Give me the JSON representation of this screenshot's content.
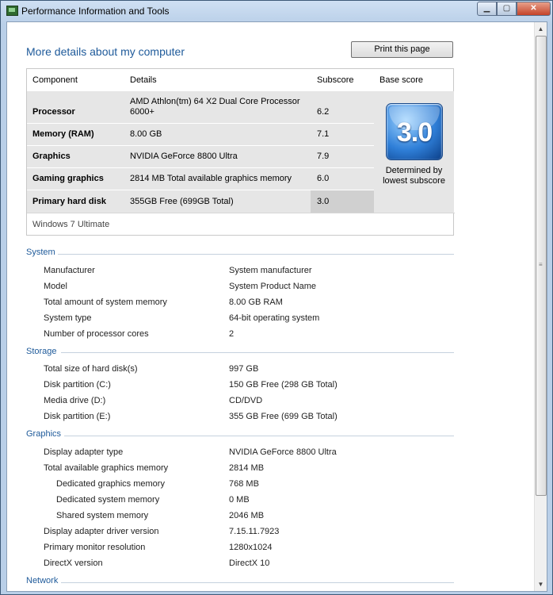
{
  "window": {
    "title": "Performance Information and Tools"
  },
  "header": {
    "heading": "More details about my computer",
    "print_label": "Print this page"
  },
  "score_table": {
    "columns": {
      "component": "Component",
      "details": "Details",
      "subscore": "Subscore",
      "base": "Base score"
    },
    "rows": [
      {
        "component": "Processor",
        "details": "AMD Athlon(tm) 64 X2 Dual Core Processor 6000+",
        "subscore": "6.2"
      },
      {
        "component": "Memory (RAM)",
        "details": "8.00 GB",
        "subscore": "7.1"
      },
      {
        "component": "Graphics",
        "details": "NVIDIA GeForce 8800 Ultra",
        "subscore": "7.9"
      },
      {
        "component": "Gaming graphics",
        "details": "2814 MB Total available graphics memory",
        "subscore": "6.0"
      },
      {
        "component": "Primary hard disk",
        "details": "355GB Free (699GB Total)",
        "subscore": "3.0"
      }
    ],
    "base_score": "3.0",
    "base_caption": "Determined by lowest subscore",
    "edition": "Windows 7 Ultimate"
  },
  "system": {
    "title": "System",
    "rows": [
      {
        "label": "Manufacturer",
        "value": "System manufacturer"
      },
      {
        "label": "Model",
        "value": "System Product Name"
      },
      {
        "label": "Total amount of system memory",
        "value": "8.00 GB RAM"
      },
      {
        "label": "System type",
        "value": "64-bit operating system"
      },
      {
        "label": "Number of processor cores",
        "value": "2"
      }
    ]
  },
  "storage": {
    "title": "Storage",
    "rows": [
      {
        "label": "Total size of hard disk(s)",
        "value": "997 GB"
      },
      {
        "label": "Disk partition (C:)",
        "value": "150 GB Free (298 GB Total)"
      },
      {
        "label": "Media drive (D:)",
        "value": "CD/DVD"
      },
      {
        "label": "Disk partition (E:)",
        "value": "355 GB Free (699 GB Total)"
      }
    ]
  },
  "graphics": {
    "title": "Graphics",
    "rows": [
      {
        "label": "Display adapter type",
        "value": "NVIDIA GeForce 8800 Ultra"
      },
      {
        "label": "Total available graphics memory",
        "value": "2814 MB"
      },
      {
        "label": "Dedicated graphics memory",
        "value": "768 MB"
      },
      {
        "label": "Dedicated system memory",
        "value": "0 MB"
      },
      {
        "label": "Shared system memory",
        "value": "2046 MB"
      },
      {
        "label": "Display adapter driver version",
        "value": "7.15.11.7923"
      },
      {
        "label": "Primary monitor resolution",
        "value": "1280x1024"
      },
      {
        "label": "DirectX version",
        "value": "DirectX 10"
      }
    ]
  },
  "network": {
    "title": "Network"
  },
  "colors": {
    "section_heading": "#1e5a9a",
    "badge": "#2f7fd8"
  }
}
